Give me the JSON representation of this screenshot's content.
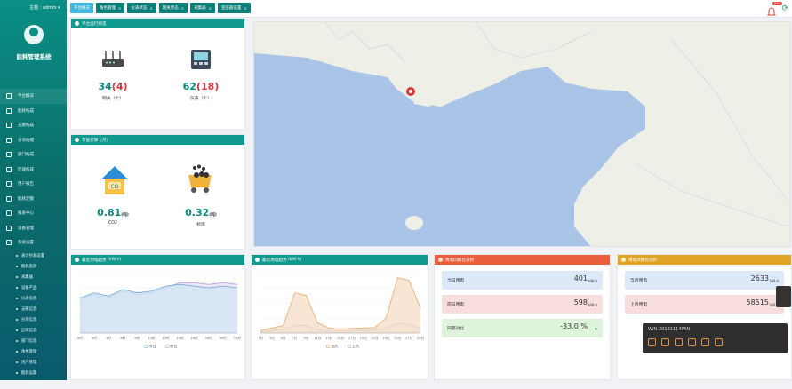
{
  "user": {
    "label": "主题 : admin ▾"
  },
  "app": {
    "title": "能耗管理系统"
  },
  "sidebar": {
    "items": [
      {
        "label": "平台概况",
        "active": true
      },
      {
        "label": "能耗构成"
      },
      {
        "label": "支路构成"
      },
      {
        "label": "分项构成"
      },
      {
        "label": "部门构成"
      },
      {
        "label": "区域构成"
      },
      {
        "label": "用户报告"
      },
      {
        "label": "能耗定额"
      },
      {
        "label": "报表中心"
      },
      {
        "label": "设备管理"
      },
      {
        "label": "系统设置"
      }
    ],
    "subitems": [
      "表计抄表设置",
      "能耗监测",
      "采集器",
      "设备产品",
      "仪表信息",
      "支路信息",
      "分项信息",
      "区域信息",
      "部门信息",
      "角色管理",
      "用户管理",
      "能耗设置",
      "一次表设置"
    ]
  },
  "tabs": [
    {
      "label": "平台概况",
      "active": true,
      "closable": false
    },
    {
      "label": "角色管理",
      "closable": true
    },
    {
      "label": "仪表状态",
      "closable": true
    },
    {
      "label": "网关状态",
      "closable": true
    },
    {
      "label": "采集器",
      "closable": true
    },
    {
      "label": "变压器设置",
      "closable": true
    }
  ],
  "notifications": {
    "badge": "99+"
  },
  "platform_status": {
    "title": "平台运行状态",
    "gateway": {
      "value": "34",
      "sub": "(4)",
      "label": "网关（个）"
    },
    "meter": {
      "value": "62",
      "sub": "(18)",
      "label": "仪表（个）"
    }
  },
  "saving": {
    "title": "节能折算（月）",
    "co2": {
      "value": "0.81",
      "unit": "(吨)",
      "label": "CO2"
    },
    "coal": {
      "value": "0.32",
      "unit": "(吨)",
      "label": "标煤"
    }
  },
  "icons": {
    "gateway": "router-icon",
    "meter": "meter-icon",
    "co2": "co2-house-icon",
    "coal": "coal-cart-icon"
  },
  "charts": {
    "today_power": {
      "title": "最近用电趋势",
      "unit": "(kW·h)",
      "legend": [
        "今日",
        "昨日"
      ],
      "chart_data": {
        "type": "area",
        "x": [
          "0时",
          "2时",
          "4时",
          "6时",
          "8时",
          "10时",
          "12时",
          "14时",
          "16时",
          "18时",
          "20时",
          "22时"
        ],
        "series": [
          {
            "name": "今日",
            "values": [
              10.5,
              12,
              11,
              13,
              12,
              12.5,
              14,
              14.5,
              14,
              13.5,
              14,
              13.5
            ]
          },
          {
            "name": "昨日",
            "values": [
              10,
              11.5,
              10.5,
              12.5,
              11.5,
              12,
              13.5,
              15,
              15,
              14.5,
              15,
              14.5
            ]
          }
        ],
        "ylim": [
          0,
          18
        ]
      }
    },
    "month_power": {
      "title": "最近用电趋势",
      "unit": "(kW·h)",
      "legend": [
        "当月",
        "上月"
      ],
      "chart_data": {
        "type": "area",
        "x": [
          "1日",
          "3日",
          "5日",
          "7日",
          "9日",
          "11日",
          "13日",
          "15日",
          "17日",
          "19日",
          "21日",
          "23日",
          "25日",
          "27日",
          "29日"
        ],
        "series": [
          {
            "name": "当月",
            "values": [
              1,
              2,
              3,
              16,
              15,
              4,
              2,
              1.5,
              1.8,
              2,
              2.2,
              6,
              22,
              21,
              10
            ]
          },
          {
            "name": "上月",
            "values": [
              0.5,
              1,
              1.5,
              3,
              3,
              1.5,
              0.8,
              0.7,
              1,
              1,
              1.2,
              2,
              4,
              3.5,
              2
            ]
          }
        ],
        "ylim": [
          0,
          24
        ]
      }
    }
  },
  "day_compare": {
    "title": "用电同期比分析",
    "rows": [
      {
        "label": "当日用电",
        "value": "401",
        "unit": "kW·h",
        "bg": "#dde8f8"
      },
      {
        "label": "前日用电",
        "value": "598",
        "unit": "kW·h",
        "bg": "#f8dddd"
      },
      {
        "label": "同期对比",
        "value": "-33.0 %",
        "unit": "▼",
        "bg": "#dff3dc"
      }
    ]
  },
  "month_compare": {
    "title": "用电环期比分析",
    "rows": [
      {
        "label": "当月用电",
        "value": "2633",
        "unit": "kW·h",
        "bg": "#dde8f8"
      },
      {
        "label": "上月用电",
        "value": "58515",
        "unit": "kW·h",
        "bg": "#f8dddd"
      }
    ]
  },
  "remote": {
    "title": "WIN-20181114PAN"
  }
}
